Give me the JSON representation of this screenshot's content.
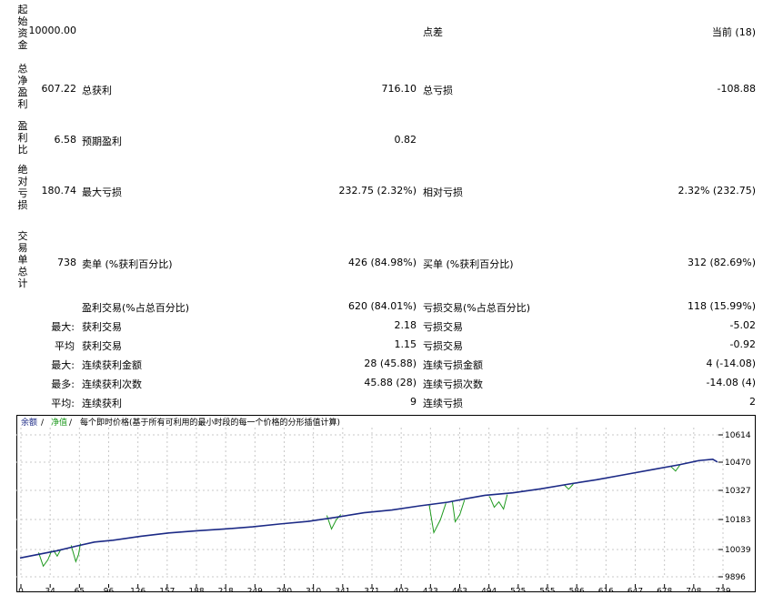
{
  "report": {
    "initial_deposit_label": "起始资金",
    "initial_deposit_value": "10000.00",
    "spread_label": "点差",
    "spread_value": "当前 (18)",
    "net_profit_label": "总净盈利",
    "net_profit_value": "607.22",
    "gross_profit_label": "总获利",
    "gross_profit_value": "716.10",
    "gross_loss_label": "总亏损",
    "gross_loss_value": "-108.88",
    "profit_factor_label": "盈利比",
    "profit_factor_value": "6.58",
    "expected_payoff_label": "预期盈利",
    "expected_payoff_value": "0.82",
    "abs_drawdown_label": "绝对亏损",
    "abs_drawdown_value": "180.74",
    "max_drawdown_label": "最大亏损",
    "max_drawdown_value": "232.75 (2.32%)",
    "rel_drawdown_label": "相对亏损",
    "rel_drawdown_value": "2.32% (232.75)",
    "total_trades_label": "交易单总计",
    "total_trades_value": "738",
    "short_label": "卖单 (%获利百分比)",
    "short_value": "426 (84.98%)",
    "long_label": "买单 (%获利百分比)",
    "long_value": "312 (82.69%)",
    "profit_trades_label": "盈利交易(%占总百分比)",
    "profit_trades_value": "620 (84.01%)",
    "loss_trades_label": "亏损交易(%占总百分比)",
    "loss_trades_value": "118 (15.99%)",
    "rows": [
      {
        "prefix": "最大:",
        "left_label": "获利交易",
        "left_value": "2.18",
        "right_label": "亏损交易",
        "right_value": "-5.02"
      },
      {
        "prefix": "平均",
        "left_label": "获利交易",
        "left_value": "1.15",
        "right_label": "亏损交易",
        "right_value": "-0.92"
      },
      {
        "prefix": "最大:",
        "left_label": "连续获利金额",
        "left_value": "28 (45.88)",
        "right_label": "连续亏损金额",
        "right_value": "4 (-14.08)"
      },
      {
        "prefix": "最多:",
        "left_label": "连续获利次数",
        "left_value": "45.88 (28)",
        "right_label": "连续亏损次数",
        "right_value": "-14.08 (4)"
      },
      {
        "prefix": "平均:",
        "left_label": "连续获利",
        "left_value": "9",
        "right_label": "连续亏损",
        "right_value": "2"
      }
    ]
  },
  "chart_data": {
    "type": "line",
    "legend_balance": "余额",
    "legend_sep1": " / ",
    "legend_equity": "净值",
    "legend_sep2": " / ",
    "legend_desc": "每个即时价格(基于所有可利用的最小时段的每一个价格的分形插值计算)",
    "colors": {
      "balance": "#1c2a86",
      "equity": "#1f9a1f",
      "grid": "#c8c8c8"
    },
    "x_ticks": [
      "0",
      "34",
      "65",
      "96",
      "126",
      "157",
      "188",
      "218",
      "249",
      "280",
      "310",
      "341",
      "371",
      "402",
      "433",
      "463",
      "494",
      "525",
      "555",
      "586",
      "616",
      "647",
      "678",
      "708",
      "739"
    ],
    "y_ticks": [
      "10614",
      "10470",
      "10327",
      "10183",
      "10039",
      "9896"
    ],
    "xlim": [
      0,
      755
    ],
    "ylim": [
      9896,
      10680
    ],
    "balance": [
      [
        0,
        9990
      ],
      [
        20,
        10010
      ],
      [
        40,
        10030
      ],
      [
        60,
        10055
      ],
      [
        80,
        10078
      ],
      [
        100,
        10088
      ],
      [
        130,
        10110
      ],
      [
        160,
        10128
      ],
      [
        190,
        10140
      ],
      [
        220,
        10150
      ],
      [
        250,
        10162
      ],
      [
        280,
        10178
      ],
      [
        310,
        10192
      ],
      [
        340,
        10215
      ],
      [
        370,
        10240
      ],
      [
        400,
        10255
      ],
      [
        430,
        10278
      ],
      [
        460,
        10298
      ],
      [
        480,
        10318
      ],
      [
        500,
        10336
      ],
      [
        530,
        10350
      ],
      [
        560,
        10372
      ],
      [
        590,
        10398
      ],
      [
        620,
        10422
      ],
      [
        650,
        10450
      ],
      [
        680,
        10478
      ],
      [
        710,
        10506
      ],
      [
        730,
        10528
      ],
      [
        745,
        10535
      ],
      [
        750,
        10520
      ]
    ],
    "equity_dips": [
      [
        [
          20,
          10020
        ],
        [
          25,
          9945
        ],
        [
          30,
          9980
        ],
        [
          34,
          10030
        ]
      ],
      [
        [
          36,
          10032
        ],
        [
          40,
          10000
        ],
        [
          44,
          10038
        ]
      ],
      [
        [
          55,
          10060
        ],
        [
          60,
          9970
        ],
        [
          63,
          10010
        ],
        [
          65,
          10070
        ]
      ],
      [
        [
          330,
          10225
        ],
        [
          335,
          10150
        ],
        [
          340,
          10200
        ],
        [
          345,
          10230
        ]
      ],
      [
        [
          440,
          10285
        ],
        [
          445,
          10130
        ],
        [
          448,
          10160
        ],
        [
          452,
          10200
        ],
        [
          458,
          10292
        ]
      ],
      [
        [
          465,
          10300
        ],
        [
          468,
          10190
        ],
        [
          473,
          10230
        ],
        [
          478,
          10310
        ]
      ],
      [
        [
          505,
          10330
        ],
        [
          510,
          10270
        ],
        [
          515,
          10300
        ],
        [
          520,
          10260
        ],
        [
          524,
          10340
        ]
      ],
      [
        [
          585,
          10395
        ],
        [
          590,
          10370
        ],
        [
          595,
          10398
        ]
      ],
      [
        [
          700,
          10495
        ],
        [
          705,
          10470
        ],
        [
          710,
          10506
        ]
      ]
    ]
  }
}
